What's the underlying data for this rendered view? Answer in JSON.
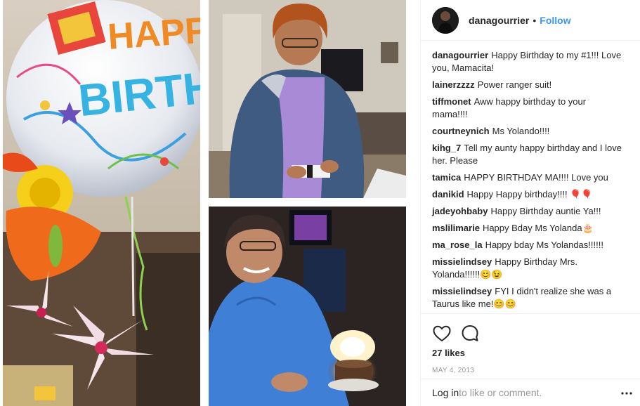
{
  "post": {
    "username": "danagourrier",
    "separator": "•",
    "follow_label": "Follow",
    "comments": [
      {
        "user": "danagourrier",
        "text": "Happy Birthday to my #1!!! Love you, Mamacita!"
      },
      {
        "user": "lainerzzzz",
        "text": "Power ranger suit!"
      },
      {
        "user": "tiffmonet",
        "text": "Aww happy birthday to your mama!!!!"
      },
      {
        "user": "courtneynich",
        "text": "Ms Yolando!!!!"
      },
      {
        "user": "kihg_7",
        "text": "Tell my aunty happy birthday and I love her. Please"
      },
      {
        "user": "tamica",
        "text": "HAPPY BIRTHDAY MA!!!! Love you"
      },
      {
        "user": "danikid",
        "text": "Happy Happy birthday!!!! 🎈🎈"
      },
      {
        "user": "jadeyohbaby",
        "text": "Happy Birthday auntie Ya!!!"
      },
      {
        "user": "mslilimarie",
        "text": "Happy Bday Ms Yolanda🎂"
      },
      {
        "user": "ma_rose_la",
        "text": "Happy bday Ms Yolandas!!!!!!"
      },
      {
        "user": "missielindsey",
        "text": "Happy Birthday Mrs. Yolanda!!!!!!😊😉"
      },
      {
        "user": "missielindsey",
        "text": "FYI I didn't realize she was a Taurus like me!😊😊"
      }
    ],
    "likes_label": "27 likes",
    "date_label": "MAY 4, 2013",
    "login_link": "Log in",
    "login_suffix": " to like or comment.",
    "icons": {
      "like": "heart-icon",
      "comment": "comment-bubble-icon",
      "more": "more-options-icon"
    },
    "colors": {
      "link_blue": "#3897f0",
      "muted_gray": "#999999",
      "text": "#262626"
    }
  },
  "balloon": {
    "line1": "HAPPY",
    "line2": "BIRTHDAY"
  }
}
